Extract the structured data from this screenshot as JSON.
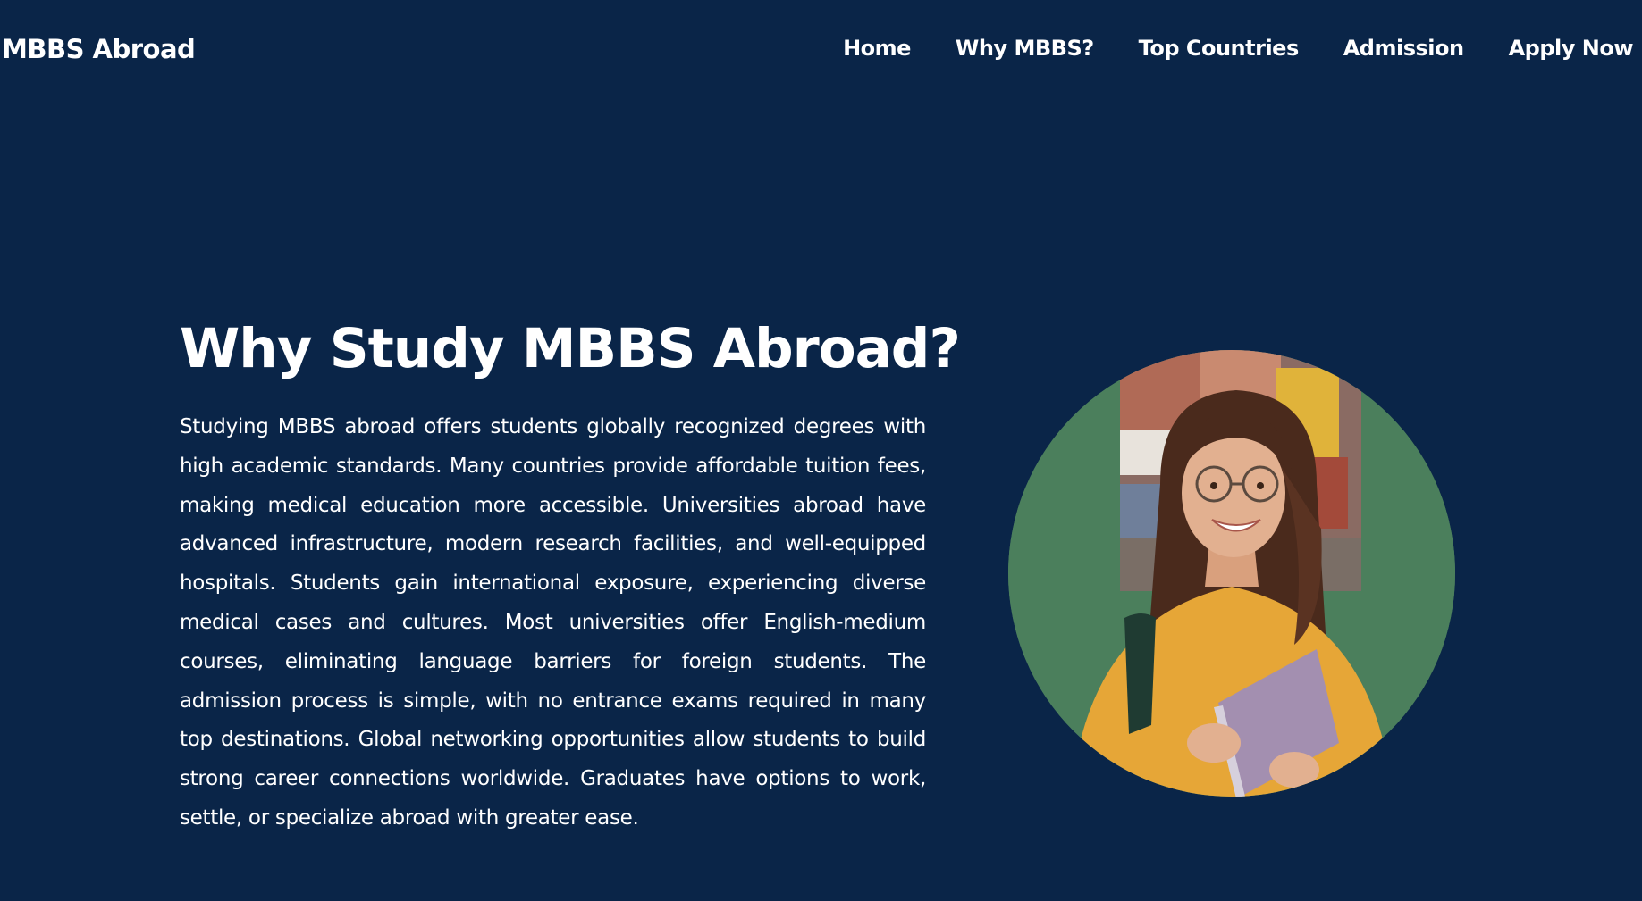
{
  "brand": {
    "name": "MBBS Abroad"
  },
  "nav": {
    "items": [
      {
        "label": "Home"
      },
      {
        "label": "Why MBBS?"
      },
      {
        "label": "Top Countries"
      },
      {
        "label": "Admission"
      },
      {
        "label": "Apply Now"
      }
    ]
  },
  "hero": {
    "title": "Why Study MBBS Abroad?",
    "paragraph": "Studying MBBS abroad offers students globally recognized degrees with high academic standards. Many countries provide affordable tuition fees, making medical education more accessible. Universities abroad have advanced infrastructure, modern research facilities, and well-equipped hospitals. Students gain international exposure, experiencing diverse medical cases and cultures. Most universities offer English-medium courses, eliminating language barriers for foreign students. The admission process is simple, with no entrance exams required in many top destinations. Global networking opportunities allow students to build strong career connections worldwide. Graduates have options to work, settle, or specialize abroad with greater ease."
  },
  "colors": {
    "background": "#0a2548",
    "text": "#ffffff",
    "photo_backdrop": "#4b7f5c"
  }
}
